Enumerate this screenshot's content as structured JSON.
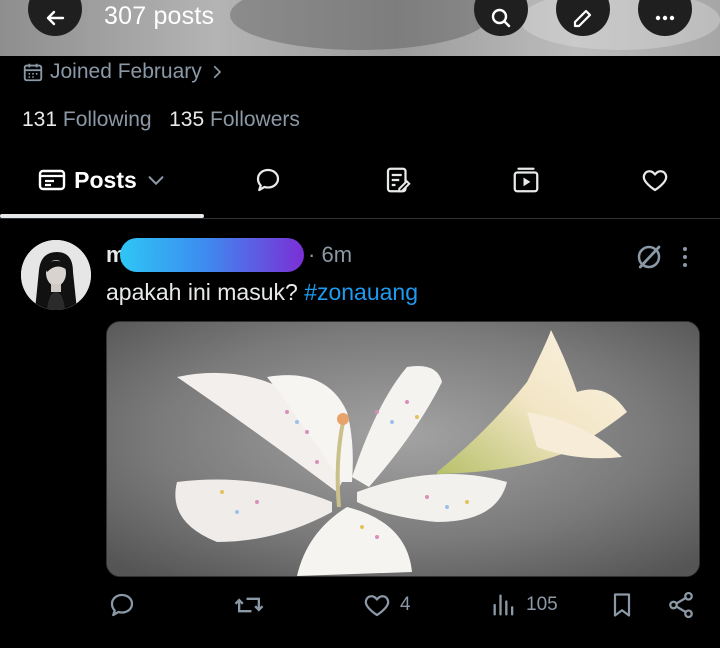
{
  "header": {
    "post_count": "307 posts",
    "back_icon": "arrow-left-icon",
    "search_icon": "search-icon",
    "edit_icon": "edit-icon",
    "more_icon": "more-horizontal-icon"
  },
  "profile": {
    "joined": "Joined February",
    "following_count": "131",
    "following_label": "Following",
    "followers_count": "135",
    "followers_label": "Followers"
  },
  "tabs": {
    "active_label": "Posts",
    "items": [
      "posts-icon",
      "reply-icon",
      "article-icon",
      "media-icon",
      "like-icon"
    ]
  },
  "post": {
    "author_initial": "m",
    "separator": "·",
    "time": "6m",
    "text": "apakah ini masuk? ",
    "hashtag": "#zonauang",
    "likes": "4",
    "views": "105"
  },
  "colors": {
    "background": "#000000",
    "text": "#e7e9ea",
    "muted": "#8b98a5",
    "link": "#1d9bf0"
  }
}
